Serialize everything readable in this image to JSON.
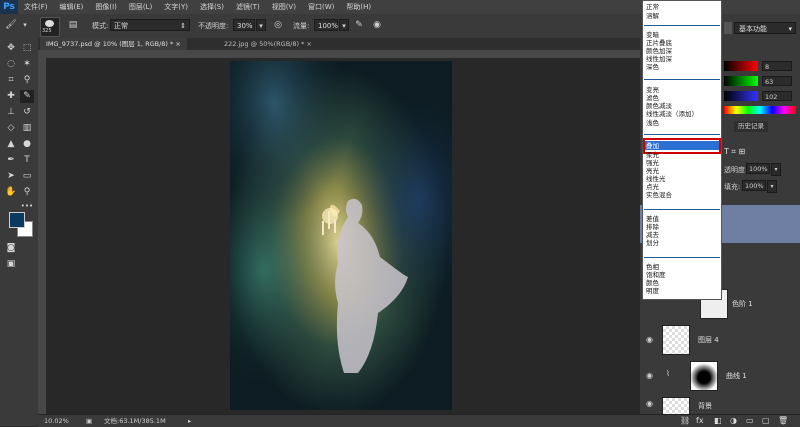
{
  "app": {
    "logo": "Ps"
  },
  "menu": [
    "文件(F)",
    "编辑(E)",
    "图像(I)",
    "图层(L)",
    "文字(Y)",
    "选择(S)",
    "滤镜(T)",
    "视图(V)",
    "窗口(W)",
    "帮助(H)"
  ],
  "options": {
    "brush_size": "325",
    "mode_label": "模式:",
    "mode_value": "正常",
    "opacity_label": "不透明度:",
    "opacity_value": "30%",
    "flow_label": "流量:",
    "flow_value": "100%"
  },
  "tabs": [
    {
      "label": "IMG_9737.psd @ 10% (图层 1, RGB/8) * ×",
      "active": true
    },
    {
      "label": "222.jpg @ 50%(RGB/8) * ×",
      "active": false
    }
  ],
  "status": {
    "zoom": "10.02%",
    "doc": "文档:63.1M/385.1M"
  },
  "workspace": "基本功能",
  "color_values": [
    "8",
    "63",
    "102"
  ],
  "panel_tabs": [
    "历史记录"
  ],
  "layers_opts": {
    "opacity_label": "透明度:",
    "opacity_value": "100%",
    "fill_label": "填充:",
    "fill_value": "100%"
  },
  "layers": [
    {
      "name": "色阶 1"
    },
    {
      "name": "图层 4"
    },
    {
      "name": "曲线 1"
    },
    {
      "name": "背景"
    }
  ],
  "blend_modes": {
    "group1": [
      "正常",
      "溶解"
    ],
    "group2": [
      "变暗",
      "正片叠底",
      "颜色加深",
      "线性加深",
      "深色"
    ],
    "group3": [
      "变亮",
      "滤色",
      "颜色减淡",
      "线性减淡（添加）",
      "浅色"
    ],
    "group4": [
      "叠加",
      "柔光",
      "强光",
      "亮光",
      "线性光",
      "点光",
      "实色混合"
    ],
    "group5": [
      "差值",
      "排除",
      "减去",
      "划分"
    ],
    "group6": [
      "色相",
      "饱和度",
      "颜色",
      "明度"
    ],
    "selected": "叠加"
  },
  "colors": {
    "foreground": "#0c3a5e",
    "background": "#ffffff",
    "accent_select": "#2b6fd3",
    "highlight_box": "#d00000"
  }
}
